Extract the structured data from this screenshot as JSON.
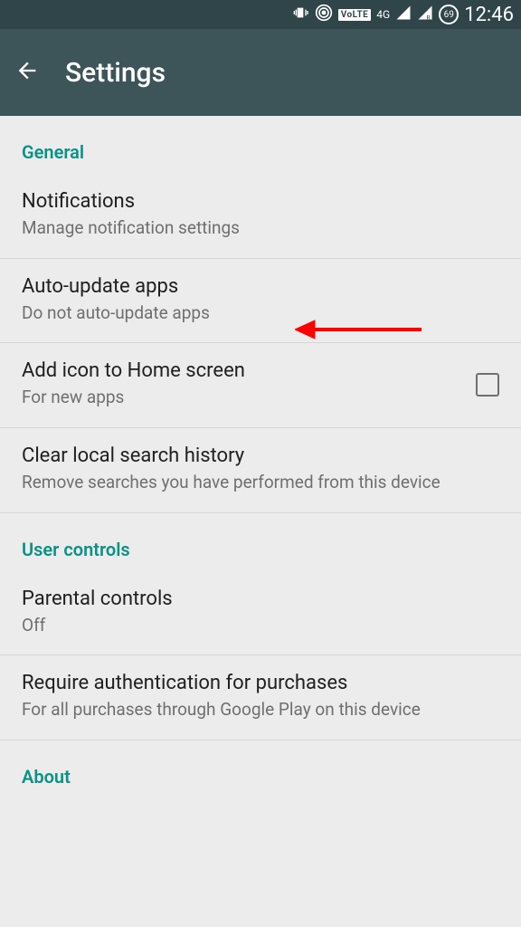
{
  "status": {
    "volte": "VoLTE",
    "net": "4G",
    "battery_pct": "69",
    "clock": "12:46"
  },
  "appbar": {
    "title": "Settings"
  },
  "sections": {
    "general": {
      "header": "General",
      "notifications": {
        "title": "Notifications",
        "sub": "Manage notification settings"
      },
      "auto_update": {
        "title": "Auto-update apps",
        "sub": "Do not auto-update apps"
      },
      "add_icon": {
        "title": "Add icon to Home screen",
        "sub": "For new apps"
      },
      "clear_history": {
        "title": "Clear local search history",
        "sub": "Remove searches you have performed from this device"
      }
    },
    "user_controls": {
      "header": "User controls",
      "parental": {
        "title": "Parental controls",
        "sub": "Off"
      },
      "auth": {
        "title": "Require authentication for purchases",
        "sub": "For all purchases through Google Play on this device"
      }
    },
    "about": {
      "header": "About"
    }
  }
}
